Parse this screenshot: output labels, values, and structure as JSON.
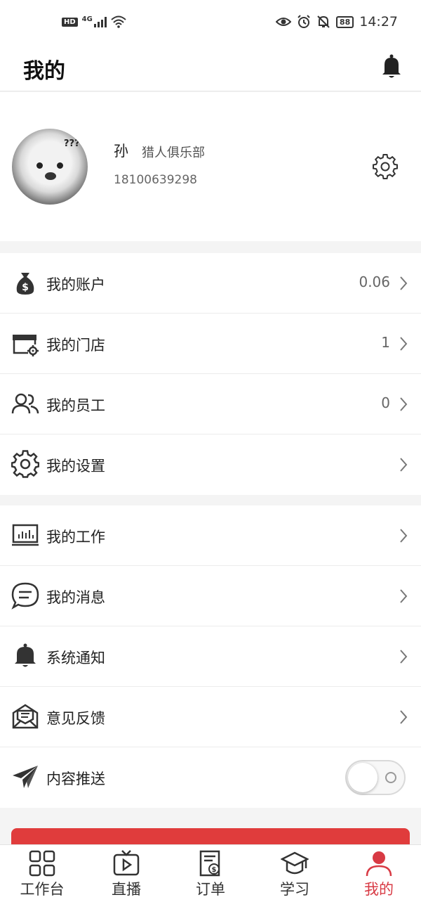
{
  "status_bar": {
    "hd": "HD",
    "network": "4G",
    "battery": "88",
    "time": "14:27"
  },
  "header": {
    "title": "我的"
  },
  "profile": {
    "name": "孙",
    "organization": "猎人俱乐部",
    "phone": "18100639298",
    "avatar_text": "???"
  },
  "menu_group_1": [
    {
      "label": "我的账户",
      "value": "0.06",
      "icon": "money-bag-icon"
    },
    {
      "label": "我的门店",
      "value": "1",
      "icon": "store-icon"
    },
    {
      "label": "我的员工",
      "value": "0",
      "icon": "staff-icon"
    },
    {
      "label": "我的设置",
      "value": "",
      "icon": "gear-icon"
    }
  ],
  "menu_group_2": [
    {
      "label": "我的工作",
      "icon": "chart-board-icon"
    },
    {
      "label": "我的消息",
      "icon": "message-icon"
    },
    {
      "label": "系统通知",
      "icon": "bell-icon"
    },
    {
      "label": "意见反馈",
      "icon": "feedback-mail-icon"
    },
    {
      "label": "内容推送",
      "icon": "paper-plane-icon",
      "toggle_on": false
    }
  ],
  "tabbar": [
    {
      "label": "工作台",
      "icon": "grid-icon",
      "active": false
    },
    {
      "label": "直播",
      "icon": "tv-play-icon",
      "active": false
    },
    {
      "label": "订单",
      "icon": "order-icon",
      "active": false
    },
    {
      "label": "学习",
      "icon": "graduation-cap-icon",
      "active": false
    },
    {
      "label": "我的",
      "icon": "person-icon",
      "active": true
    }
  ],
  "colors": {
    "accent": "#d83a44",
    "logout_button": "#e03c3c",
    "background": "#f4f4f4"
  }
}
